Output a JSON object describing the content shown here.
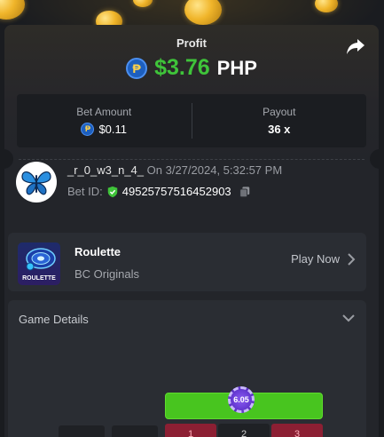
{
  "header": {
    "profit_label": "Profit",
    "currency_symbol": "₱",
    "profit_amount": "$3.76",
    "profit_currency": "PHP"
  },
  "stats": {
    "bet_amount_label": "Bet Amount",
    "bet_amount_value": "$0.11",
    "payout_label": "Payout",
    "payout_value": "36 x"
  },
  "bet": {
    "username": "_r_0_w3_n_4_",
    "timestamp": "On 3/27/2024, 5:32:57 PM",
    "bet_id_label": "Bet ID:",
    "bet_id": "49525757516452903"
  },
  "game": {
    "thumb_label": "ROULETTE",
    "name": "Roulette",
    "provider": "BC Originals",
    "play_label": "Play Now"
  },
  "details": {
    "title": "Game Details",
    "chip_value": "6.05",
    "cells": [
      "1",
      "2",
      "3"
    ]
  },
  "colors": {
    "profit_green": "#3fc43a",
    "card_bg": "#23252a",
    "zero_cell": "#48c51f",
    "red_cell": "#8c1f33",
    "chip_purple": "#6b3ed8"
  },
  "icons": {
    "share": "share-icon",
    "copy": "copy-icon",
    "verified": "shield-check-icon",
    "chevron_right": "chevron-right-icon",
    "chevron_down": "chevron-down-icon",
    "peso_coin": "peso-coin-icon"
  }
}
